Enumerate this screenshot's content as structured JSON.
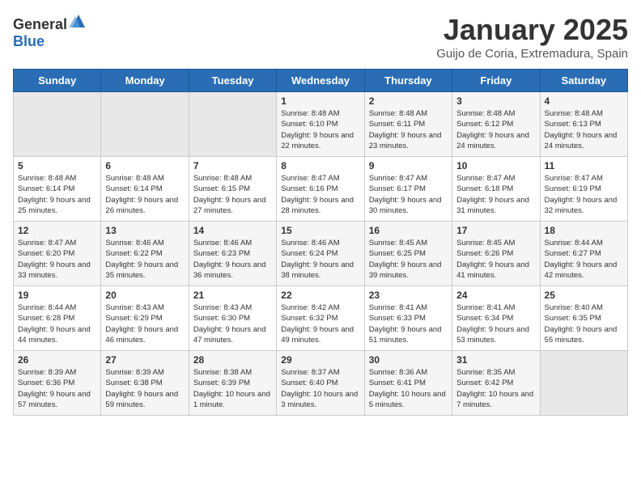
{
  "logo": {
    "general": "General",
    "blue": "Blue"
  },
  "title": "January 2025",
  "subtitle": "Guijo de Coria, Extremadura, Spain",
  "weekdays": [
    "Sunday",
    "Monday",
    "Tuesday",
    "Wednesday",
    "Thursday",
    "Friday",
    "Saturday"
  ],
  "weeks": [
    [
      {
        "day": "",
        "info": ""
      },
      {
        "day": "",
        "info": ""
      },
      {
        "day": "",
        "info": ""
      },
      {
        "day": "1",
        "info": "Sunrise: 8:48 AM\nSunset: 6:10 PM\nDaylight: 9 hours and 22 minutes."
      },
      {
        "day": "2",
        "info": "Sunrise: 8:48 AM\nSunset: 6:11 PM\nDaylight: 9 hours and 23 minutes."
      },
      {
        "day": "3",
        "info": "Sunrise: 8:48 AM\nSunset: 6:12 PM\nDaylight: 9 hours and 24 minutes."
      },
      {
        "day": "4",
        "info": "Sunrise: 8:48 AM\nSunset: 6:13 PM\nDaylight: 9 hours and 24 minutes."
      }
    ],
    [
      {
        "day": "5",
        "info": "Sunrise: 8:48 AM\nSunset: 6:14 PM\nDaylight: 9 hours and 25 minutes."
      },
      {
        "day": "6",
        "info": "Sunrise: 8:48 AM\nSunset: 6:14 PM\nDaylight: 9 hours and 26 minutes."
      },
      {
        "day": "7",
        "info": "Sunrise: 8:48 AM\nSunset: 6:15 PM\nDaylight: 9 hours and 27 minutes."
      },
      {
        "day": "8",
        "info": "Sunrise: 8:47 AM\nSunset: 6:16 PM\nDaylight: 9 hours and 28 minutes."
      },
      {
        "day": "9",
        "info": "Sunrise: 8:47 AM\nSunset: 6:17 PM\nDaylight: 9 hours and 30 minutes."
      },
      {
        "day": "10",
        "info": "Sunrise: 8:47 AM\nSunset: 6:18 PM\nDaylight: 9 hours and 31 minutes."
      },
      {
        "day": "11",
        "info": "Sunrise: 8:47 AM\nSunset: 6:19 PM\nDaylight: 9 hours and 32 minutes."
      }
    ],
    [
      {
        "day": "12",
        "info": "Sunrise: 8:47 AM\nSunset: 6:20 PM\nDaylight: 9 hours and 33 minutes."
      },
      {
        "day": "13",
        "info": "Sunrise: 8:46 AM\nSunset: 6:22 PM\nDaylight: 9 hours and 35 minutes."
      },
      {
        "day": "14",
        "info": "Sunrise: 8:46 AM\nSunset: 6:23 PM\nDaylight: 9 hours and 36 minutes."
      },
      {
        "day": "15",
        "info": "Sunrise: 8:46 AM\nSunset: 6:24 PM\nDaylight: 9 hours and 38 minutes."
      },
      {
        "day": "16",
        "info": "Sunrise: 8:45 AM\nSunset: 6:25 PM\nDaylight: 9 hours and 39 minutes."
      },
      {
        "day": "17",
        "info": "Sunrise: 8:45 AM\nSunset: 6:26 PM\nDaylight: 9 hours and 41 minutes."
      },
      {
        "day": "18",
        "info": "Sunrise: 8:44 AM\nSunset: 6:27 PM\nDaylight: 9 hours and 42 minutes."
      }
    ],
    [
      {
        "day": "19",
        "info": "Sunrise: 8:44 AM\nSunset: 6:28 PM\nDaylight: 9 hours and 44 minutes."
      },
      {
        "day": "20",
        "info": "Sunrise: 8:43 AM\nSunset: 6:29 PM\nDaylight: 9 hours and 46 minutes."
      },
      {
        "day": "21",
        "info": "Sunrise: 8:43 AM\nSunset: 6:30 PM\nDaylight: 9 hours and 47 minutes."
      },
      {
        "day": "22",
        "info": "Sunrise: 8:42 AM\nSunset: 6:32 PM\nDaylight: 9 hours and 49 minutes."
      },
      {
        "day": "23",
        "info": "Sunrise: 8:41 AM\nSunset: 6:33 PM\nDaylight: 9 hours and 51 minutes."
      },
      {
        "day": "24",
        "info": "Sunrise: 8:41 AM\nSunset: 6:34 PM\nDaylight: 9 hours and 53 minutes."
      },
      {
        "day": "25",
        "info": "Sunrise: 8:40 AM\nSunset: 6:35 PM\nDaylight: 9 hours and 55 minutes."
      }
    ],
    [
      {
        "day": "26",
        "info": "Sunrise: 8:39 AM\nSunset: 6:36 PM\nDaylight: 9 hours and 57 minutes."
      },
      {
        "day": "27",
        "info": "Sunrise: 8:39 AM\nSunset: 6:38 PM\nDaylight: 9 hours and 59 minutes."
      },
      {
        "day": "28",
        "info": "Sunrise: 8:38 AM\nSunset: 6:39 PM\nDaylight: 10 hours and 1 minute."
      },
      {
        "day": "29",
        "info": "Sunrise: 8:37 AM\nSunset: 6:40 PM\nDaylight: 10 hours and 3 minutes."
      },
      {
        "day": "30",
        "info": "Sunrise: 8:36 AM\nSunset: 6:41 PM\nDaylight: 10 hours and 5 minutes."
      },
      {
        "day": "31",
        "info": "Sunrise: 8:35 AM\nSunset: 6:42 PM\nDaylight: 10 hours and 7 minutes."
      },
      {
        "day": "",
        "info": ""
      }
    ]
  ]
}
